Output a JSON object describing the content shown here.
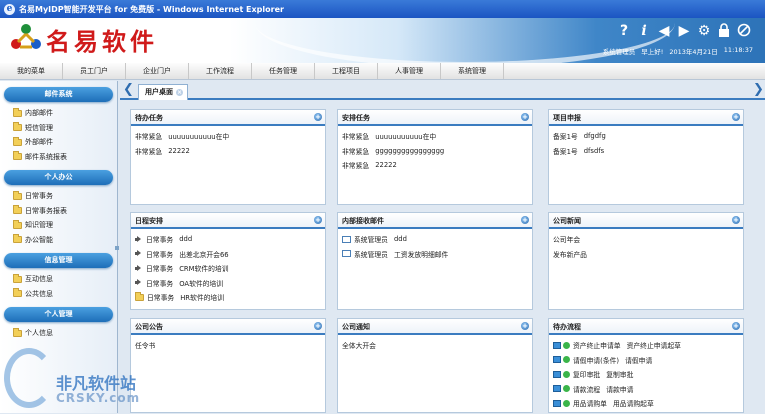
{
  "window": {
    "title": "名易MyIDP智能开发平台 for 免费版 - Windows Internet Explorer"
  },
  "header": {
    "logo_text": "名易软件",
    "icons": [
      "help-icon",
      "info-icon",
      "back-arrow-icon",
      "forward-arrow-icon",
      "settings-gear-icon",
      "lock-icon",
      "close-circle-icon"
    ],
    "user": "系统管理员",
    "greeting": "早上好!",
    "date": "2013年4月21日",
    "time": "11:18:37"
  },
  "nav": [
    "我的菜单",
    "员工门户",
    "企业门户",
    "工作流程",
    "任务管理",
    "工程项目",
    "人事管理",
    "系统管理"
  ],
  "sidebar": {
    "sections": [
      {
        "title": "邮件系统",
        "items": [
          "内部邮件",
          "短信管理",
          "外部邮件",
          "邮件系统报表"
        ]
      },
      {
        "title": "个人办公",
        "items": [
          "日常事务",
          "日常事务报表",
          "知识管理",
          "办公智能"
        ]
      },
      {
        "title": "信息管理",
        "items": [
          "互动信息",
          "公共信息"
        ]
      },
      {
        "title": "个人管理",
        "items": [
          "个人信息"
        ]
      }
    ]
  },
  "tabs": {
    "active": "用户桌面",
    "close_glyph": "×"
  },
  "panels": {
    "p1": {
      "title": "待办任务",
      "rows": [
        {
          "a": "非常紧急",
          "b": "uuuuuuuuuuu在中"
        },
        {
          "a": "非常紧急",
          "b": "22222"
        }
      ]
    },
    "p2": {
      "title": "安排任务",
      "rows": [
        {
          "a": "非常紧急",
          "b": "uuuuuuuuuuu在中"
        },
        {
          "a": "非常紧急",
          "b": "gggggggggggggggg"
        },
        {
          "a": "非常紧急",
          "b": "22222"
        }
      ]
    },
    "p3": {
      "title": "项目申报",
      "rows": [
        {
          "a": "备案1号",
          "b": "dfgdfg"
        },
        {
          "a": "备案1号",
          "b": "dfsdfs"
        }
      ]
    },
    "p4": {
      "title": "日程安排",
      "rows": [
        {
          "a": "日常事务",
          "b": "ddd"
        },
        {
          "a": "日常事务",
          "b": "出差北京开会66"
        },
        {
          "a": "日常事务",
          "b": "CRM软件的培训"
        },
        {
          "a": "日常事务",
          "b": "OA软件的培训"
        },
        {
          "a": "日常事务",
          "b": "HR软件的培训"
        }
      ]
    },
    "p5": {
      "title": "内部接收邮件",
      "rows": [
        {
          "a": "系统管理员",
          "b": "ddd"
        },
        {
          "a": "系统管理员",
          "b": "工资发放明细邮件"
        }
      ]
    },
    "p6": {
      "title": "公司新闻",
      "rows": [
        {
          "a": "公司年会",
          "b": ""
        },
        {
          "a": "发布新产品",
          "b": ""
        }
      ]
    },
    "p7": {
      "title": "公司公告",
      "rows": [
        {
          "a": "任令书",
          "b": ""
        }
      ]
    },
    "p8": {
      "title": "公司通知",
      "rows": [
        {
          "a": "全体大开会",
          "b": ""
        }
      ]
    },
    "p9": {
      "title": "待办流程",
      "rows": [
        {
          "a": "资产终止申请单",
          "b": "资产终止申请起草"
        },
        {
          "a": "请假申请(条件)",
          "b": "请假申请"
        },
        {
          "a": "复印审批",
          "b": "复制审批"
        },
        {
          "a": "请款流程",
          "b": "请款申请"
        },
        {
          "a": "用品请购单",
          "b": "用品请购起草"
        }
      ]
    }
  },
  "watermark": {
    "cn": "非凡软件站",
    "en": "CRSKY.com"
  },
  "colors": {
    "accent": "#3b7cc0",
    "logo_red": "#d01a1a",
    "side_head": "#1d6eb8"
  }
}
